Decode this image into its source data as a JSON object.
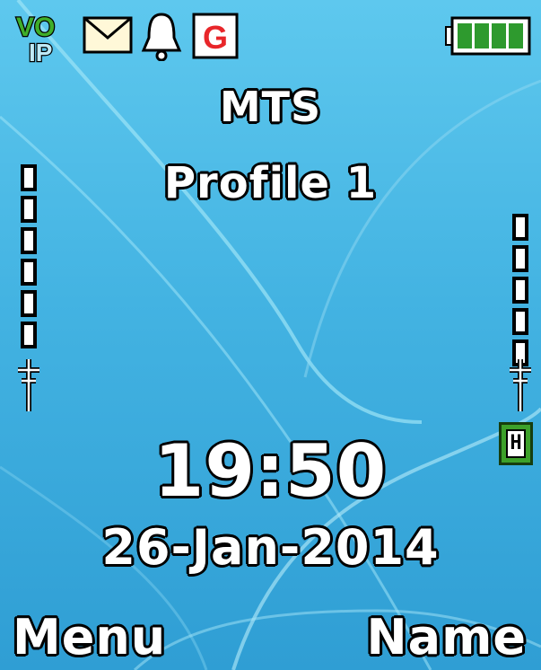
{
  "status_bar": {
    "icons": [
      "voip-icon",
      "mail-icon",
      "bell-icon",
      "gprs-icon",
      "battery-icon"
    ],
    "voip_text_top": "VO",
    "voip_text_bottom": "IP",
    "gprs_letter": "G",
    "battery_level": 1.0
  },
  "operator": "MTS",
  "profile": "Profile 1",
  "clock": "19:50",
  "date": "26-Jan-2014",
  "signal": {
    "sim1_bars": 6,
    "sim2_bars": 5,
    "indicator_letter": "H"
  },
  "softkeys": {
    "left": "Menu",
    "right": "Name"
  },
  "colors": {
    "wallpaper_top": "#5ec8ee",
    "wallpaper_bottom": "#2f9ed4",
    "voip_green": "#3fae2a",
    "gprs_red": "#e8262a",
    "battery_green": "#2e9a2e",
    "hd_green": "#3da12a"
  }
}
